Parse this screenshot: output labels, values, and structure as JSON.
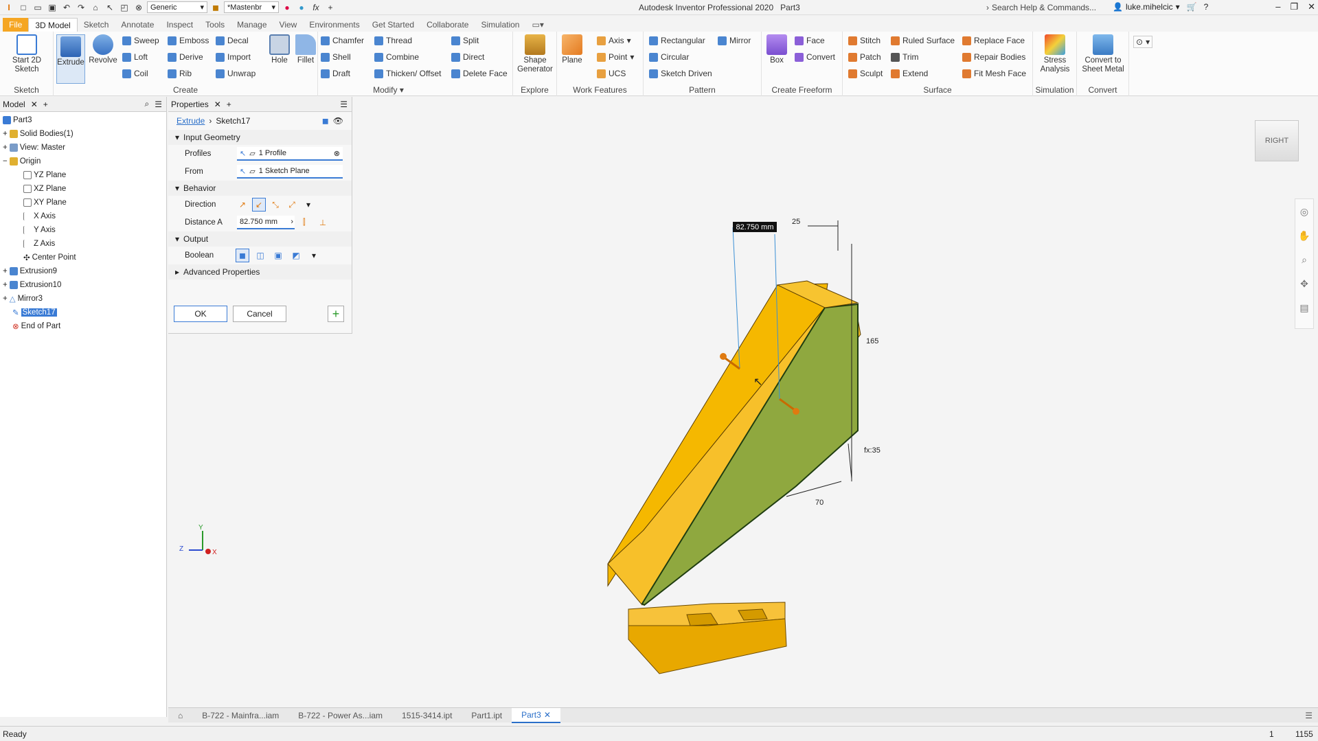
{
  "titlebar": {
    "material": "Generic",
    "appearance": "*Mastenbr",
    "app_title": "Autodesk Inventor Professional 2020",
    "doc_title": "Part3",
    "search_placeholder": "Search Help & Commands...",
    "user": "luke.mihelcic"
  },
  "tabs": [
    "File",
    "3D Model",
    "Sketch",
    "Annotate",
    "Inspect",
    "Tools",
    "Manage",
    "View",
    "Environments",
    "Get Started",
    "Collaborate",
    "Simulation"
  ],
  "ribbon": {
    "sketch": {
      "label": "Sketch",
      "start": "Start 2D Sketch"
    },
    "create": {
      "label": "Create",
      "extrude": "Extrude",
      "revolve": "Revolve",
      "sweep": "Sweep",
      "loft": "Loft",
      "coil": "Coil",
      "emboss": "Emboss",
      "derive": "Derive",
      "rib": "Rib",
      "decal": "Decal",
      "import": "Import",
      "unwrap": "Unwrap"
    },
    "modify": {
      "label": "Modify",
      "hole": "Hole",
      "fillet": "Fillet",
      "chamfer": "Chamfer",
      "shell": "Shell",
      "draft": "Draft",
      "thread": "Thread",
      "combine": "Combine",
      "thicken": "Thicken/ Offset",
      "split": "Split",
      "direct": "Direct",
      "delete_face": "Delete Face"
    },
    "explore": {
      "label": "Explore",
      "shape_generator": "Shape Generator"
    },
    "work_features": {
      "label": "Work Features",
      "plane": "Plane",
      "axis": "Axis",
      "point": "Point",
      "ucs": "UCS"
    },
    "pattern": {
      "label": "Pattern",
      "rectangular": "Rectangular",
      "circular": "Circular",
      "sketch_driven": "Sketch Driven",
      "mirror": "Mirror"
    },
    "freeform": {
      "label": "Create Freeform",
      "box": "Box",
      "face": "Face",
      "convert": "Convert"
    },
    "surface": {
      "label": "Surface",
      "stitch": "Stitch",
      "patch": "Patch",
      "sculpt": "Sculpt",
      "ruled_surface": "Ruled Surface",
      "trim": "Trim",
      "extend": "Extend",
      "replace_face": "Replace Face",
      "repair_bodies": "Repair Bodies",
      "fit_mesh_face": "Fit Mesh Face"
    },
    "simulation": {
      "label": "Simulation",
      "stress": "Stress Analysis"
    },
    "convert": {
      "label": "Convert",
      "sheet_metal": "Convert to Sheet Metal"
    }
  },
  "model_panel": {
    "tab": "Model",
    "tree": [
      "Part3",
      "Solid Bodies(1)",
      "View: Master",
      "Origin",
      "YZ Plane",
      "XZ Plane",
      "XY Plane",
      "X Axis",
      "Y Axis",
      "Z Axis",
      "Center Point",
      "Extrusion9",
      "Extrusion10",
      "Mirror3",
      "Sketch17",
      "End of Part"
    ]
  },
  "properties": {
    "tab": "Properties",
    "breadcrumb_cmd": "Extrude",
    "breadcrumb_item": "Sketch17",
    "input_geometry": "Input Geometry",
    "profiles_label": "Profiles",
    "profiles_value": "1 Profile",
    "from_label": "From",
    "from_value": "1 Sketch Plane",
    "behavior": "Behavior",
    "direction_label": "Direction",
    "distance_label": "Distance A",
    "distance_value": "82.750 mm",
    "output": "Output",
    "boolean_label": "Boolean",
    "advanced": "Advanced Properties",
    "ok": "OK",
    "cancel": "Cancel"
  },
  "viewport": {
    "dim_input": "82.750 mm",
    "dim_25": "25",
    "dim_165": "165",
    "dim_35": "fx:35",
    "dim_70": "70",
    "viewcube": "RIGHT"
  },
  "doc_tabs": [
    "B-722 - Mainfra...iam",
    "B-722 - Power As...iam",
    "1515-3414.ipt",
    "Part1.ipt",
    "Part3"
  ],
  "status": {
    "text": "Ready",
    "n1": "1",
    "n2": "1155"
  },
  "colors": {
    "accent": "#f5a623",
    "part": "#f5b800",
    "face_selected": "#8fa83f",
    "select_blue": "#3a7bd5"
  }
}
